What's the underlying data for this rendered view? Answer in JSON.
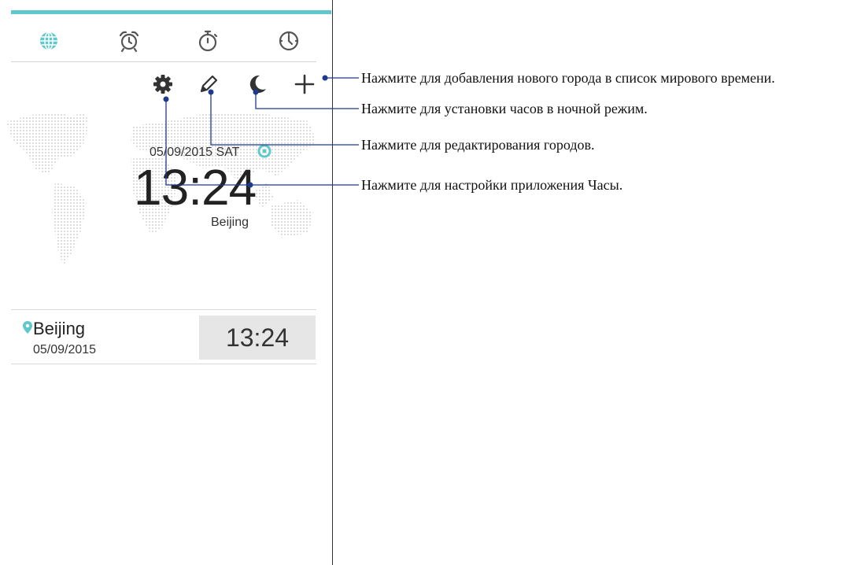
{
  "tabs": [
    {
      "name": "world-clock",
      "icon": "globe-icon",
      "active": true
    },
    {
      "name": "alarm",
      "icon": "alarm-clock-icon",
      "active": false
    },
    {
      "name": "stopwatch",
      "icon": "stopwatch-icon",
      "active": false
    },
    {
      "name": "timer",
      "icon": "timer-icon",
      "active": false
    }
  ],
  "toolbar": [
    "gear-icon",
    "pencil-icon",
    "moon-icon",
    "plus-icon"
  ],
  "main_clock": {
    "date": "05/09/2015 SAT",
    "time": "13:24",
    "city": "Beijing"
  },
  "city_list": [
    {
      "city": "Beijing",
      "date": "05/09/2015",
      "time": "13:24"
    }
  ],
  "annotations": {
    "add_city": "Нажмите для добавления нового города в список мирового времени.",
    "night_mode": "Нажмите для установки часов в ночной режим.",
    "edit_cities": "Нажмите для редактирования городов.",
    "settings": "Нажмите для настройки приложения Часы."
  },
  "colors": {
    "accent": "#5fc8cc",
    "map_dots": "#c8c8c8",
    "callout_line": "#1e3a8a"
  }
}
